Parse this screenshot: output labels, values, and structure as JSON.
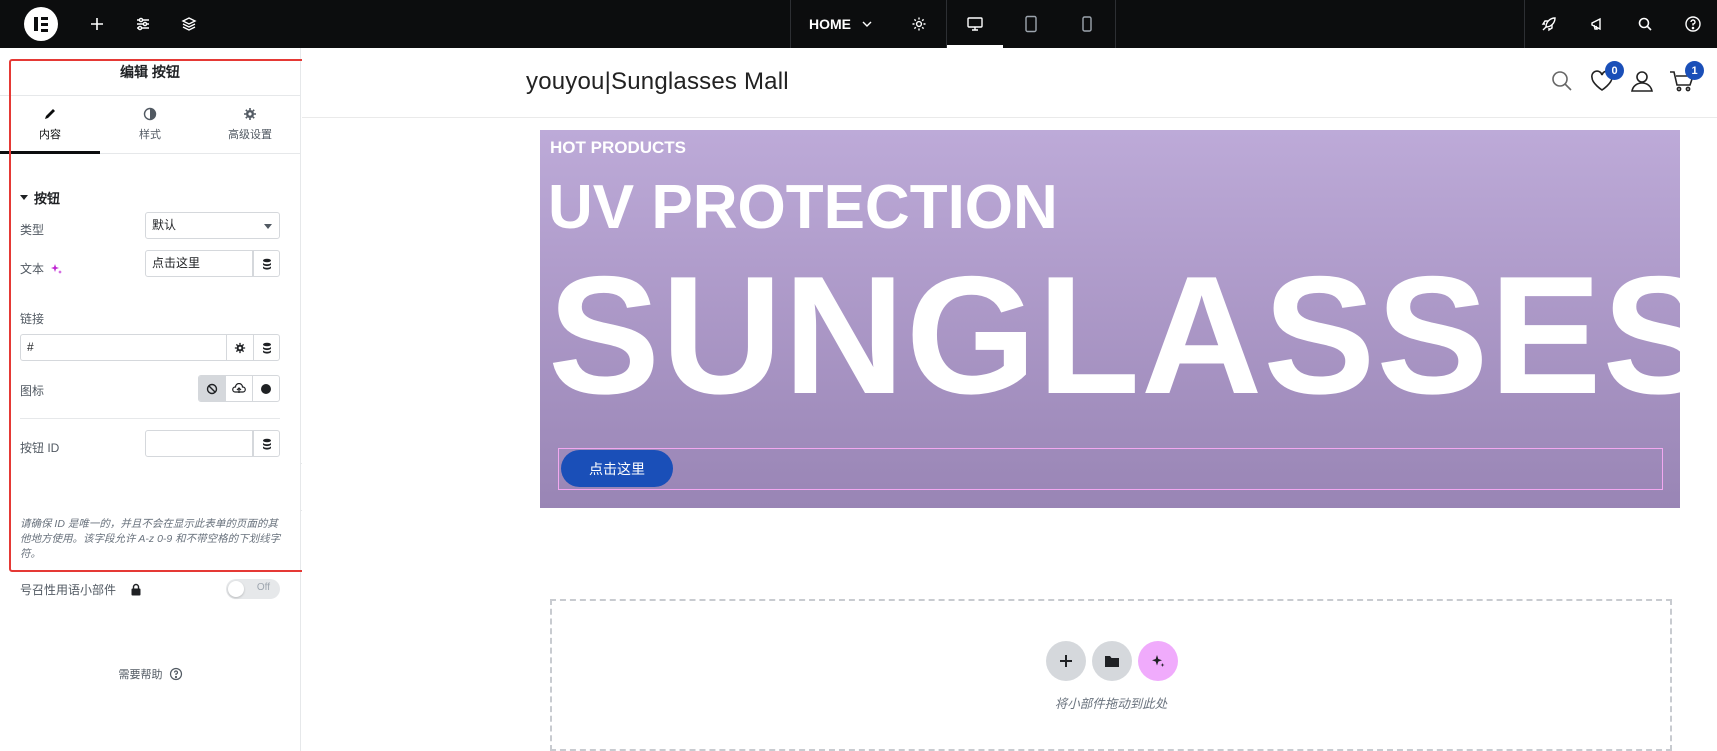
{
  "topbar": {
    "page_name": "HOME",
    "left_icons": [
      "add-icon",
      "settings-sliders-icon",
      "layers-icon"
    ],
    "devices": [
      "desktop-icon",
      "tablet-icon",
      "mobile-icon"
    ],
    "right_icons": [
      "rocket-icon",
      "megaphone-icon",
      "search-icon",
      "help-icon"
    ]
  },
  "panel": {
    "title": "编辑 按钮",
    "tabs": [
      {
        "label": "内容",
        "icon": "pencil-icon",
        "active": true
      },
      {
        "label": "样式",
        "icon": "half-circle-icon",
        "active": false
      },
      {
        "label": "高级设置",
        "icon": "gear-icon",
        "active": false
      }
    ],
    "section": "按钮",
    "type_label": "类型",
    "type_value": "默认",
    "text_label": "文本",
    "text_value": "点击这里",
    "link_label": "链接",
    "link_value": "#",
    "icon_label": "图标",
    "id_label": "按钮 ID",
    "id_value": "",
    "hint": "请确保 ID 是唯一的，并且不会在显示此表单的页面的其他地方使用。该字段允许 A-z 0-9 和不带空格的下划线字符。",
    "cta_label": "号召性用语小部件",
    "toggle_text": "Off",
    "help": "需要帮助"
  },
  "site": {
    "title": "youyou|Sunglasses Mall",
    "wishlist_count": "0",
    "cart_count": "1"
  },
  "hero": {
    "eyebrow": "HOT PRODUCTS",
    "heading": "UV PROTECTION",
    "big": "SUNGLASSES",
    "button": "点击这里",
    "colors": {
      "top": "#bdaad8",
      "bottom": "#9985b5",
      "button": "#1a4fb8"
    }
  },
  "dropzone": {
    "text": "将小部件拖动到此处"
  }
}
